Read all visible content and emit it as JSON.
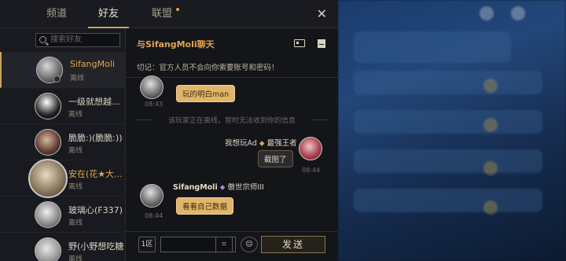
{
  "tabs": [
    {
      "label": "频道",
      "active": false
    },
    {
      "label": "好友",
      "active": true
    },
    {
      "label": "联盟",
      "active": false,
      "notification": true
    }
  ],
  "close_label": "✕",
  "search": {
    "placeholder": "搜索好友"
  },
  "friends": [
    {
      "name": "SifangMoli",
      "status": "离线",
      "selected": true
    },
    {
      "name": "一级就想越...",
      "status": "离线",
      "selected": false
    },
    {
      "name": "脆脆:)(脆脆:))",
      "status": "离线",
      "selected": false
    },
    {
      "name": "安在(花★大...",
      "status": "离线",
      "selected": false
    },
    {
      "name": "玻璃心(F337)",
      "status": "离线",
      "selected": false
    },
    {
      "name": "野(小野想吃糖)",
      "status": "离线",
      "selected": false
    }
  ],
  "chat": {
    "title": "与SifangMoli聊天",
    "warning": "切记：官方人员不会向你索要账号和密码！",
    "system_line": "该玩家正在离线，暂时无法收到你的信息",
    "messages": [
      {
        "from": "other",
        "text": "玩的明白man",
        "time": "08:43"
      },
      {
        "from": "self",
        "sender": "我想玩Ad",
        "sender_title": "最强王者",
        "text": "截图了",
        "time": "08:44"
      },
      {
        "from": "other",
        "sender": "SifangMoli",
        "sender_title": "傲世宗师III",
        "text": "看看自己数据",
        "time": "08:44"
      }
    ],
    "input": {
      "placeholder": "",
      "left_btn": "1区",
      "send_label": "发送"
    }
  }
}
